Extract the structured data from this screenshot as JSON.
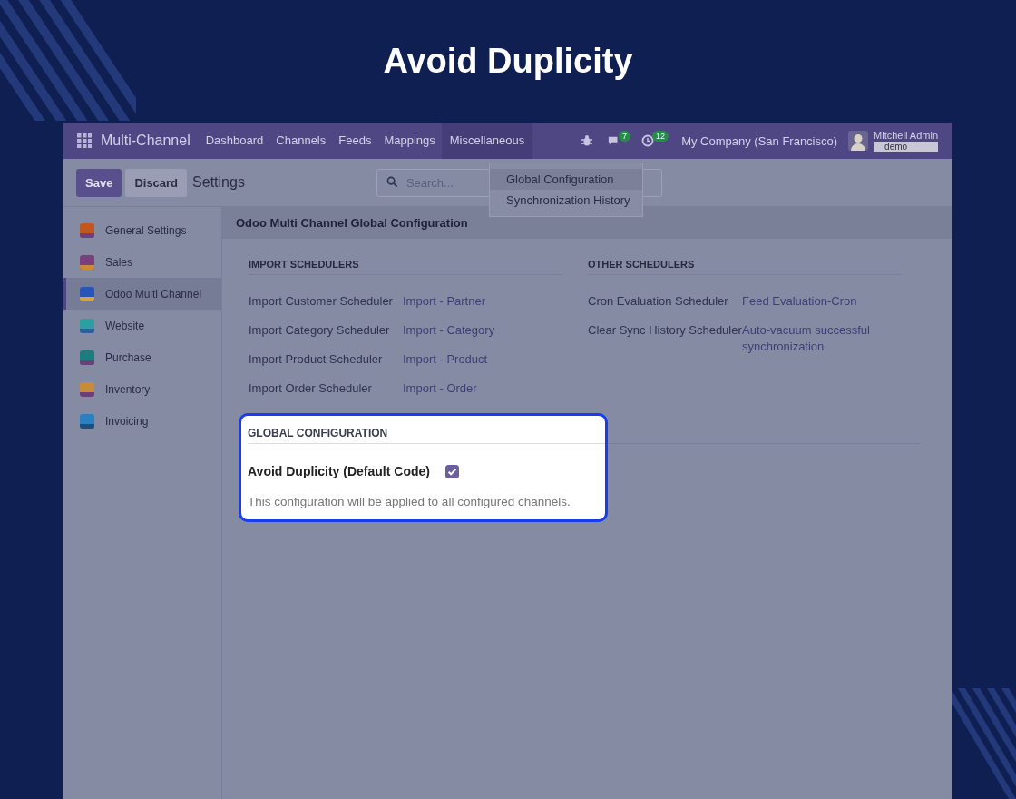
{
  "headline": "Avoid Duplicity",
  "navbar": {
    "app_name": "Multi-Channel",
    "menu": [
      {
        "label": "Dashboard",
        "selected": false
      },
      {
        "label": "Channels",
        "selected": false
      },
      {
        "label": "Feeds",
        "selected": false
      },
      {
        "label": "Mappings",
        "selected": false
      },
      {
        "label": "Miscellaneous",
        "selected": true
      }
    ],
    "messages_count": "7",
    "activities_count": "12",
    "company": "My Company (San Francisco)",
    "user": "Mitchell Admin",
    "database": "demo"
  },
  "control_panel": {
    "save": "Save",
    "discard": "Discard",
    "breadcrumb": "Settings",
    "search": {
      "placeholder": "Search..."
    }
  },
  "dropdown": [
    {
      "label": "Global Configuration",
      "selected": true
    },
    {
      "label": "Synchronization History",
      "selected": false
    }
  ],
  "sidebar": {
    "items": [
      {
        "label": "General Settings",
        "selected": false
      },
      {
        "label": "Sales",
        "selected": false
      },
      {
        "label": "Odoo Multi Channel",
        "selected": true
      },
      {
        "label": "Website",
        "selected": false
      },
      {
        "label": "Purchase",
        "selected": false
      },
      {
        "label": "Inventory",
        "selected": false
      },
      {
        "label": "Invoicing",
        "selected": false
      }
    ]
  },
  "content": {
    "title": "Odoo Multi Channel Global Configuration",
    "sections": [
      {
        "title": "IMPORT SCHEDULERS",
        "rows": [
          {
            "label": "Import Customer Scheduler",
            "value": "Import - Partner"
          },
          {
            "label": "Import Category Scheduler",
            "value": "Import - Category"
          },
          {
            "label": "Import Product Scheduler",
            "value": "Import - Product"
          },
          {
            "label": "Import Order Scheduler",
            "value": "Import - Order"
          }
        ]
      },
      {
        "title": "OTHER SCHEDULERS",
        "rows": [
          {
            "label": "Cron Evaluation Scheduler",
            "value": "Feed Evaluation-Cron"
          },
          {
            "label": "Clear Sync History Scheduler",
            "value": "Auto-vacuum successful synchronization"
          }
        ]
      }
    ],
    "global": {
      "title": "GLOBAL CONFIGURATION",
      "option": "Avoid Duplicity (Default Code)",
      "checked": true,
      "note": "This configuration will be applied to all configured channels."
    }
  }
}
